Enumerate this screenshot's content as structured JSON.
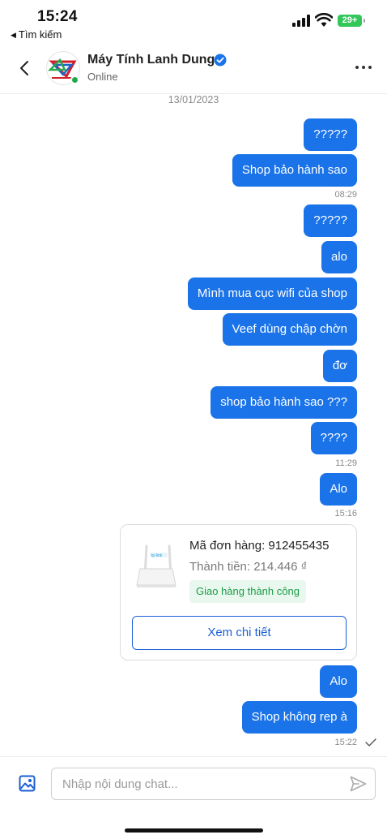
{
  "status_bar": {
    "time": "15:24",
    "back_label": "Tìm kiếm",
    "battery": "29+"
  },
  "header": {
    "shop_name": "Máy Tính Lanh Dung",
    "status": "Online"
  },
  "chat": {
    "date": "13/01/2023",
    "messages": [
      {
        "text": "?????"
      },
      {
        "text": "Shop bảo hành sao"
      },
      {
        "text": "?????"
      },
      {
        "text": "alo"
      },
      {
        "text": "Mình mua cục wifi của shop"
      },
      {
        "text": "Veef dùng chập chờn"
      },
      {
        "text": "đơ"
      },
      {
        "text": "shop bảo hành sao ???"
      },
      {
        "text": "????"
      },
      {
        "text": "Alo"
      },
      {
        "text": "Alo"
      },
      {
        "text": "Shop không rep à"
      }
    ],
    "timestamps": [
      "08:29",
      "11:29",
      "15:16",
      "15:22"
    ],
    "order": {
      "order_id": "Mã đơn hàng: 912455435",
      "total": "Thành tiền: 214.446 ₫",
      "status": "Giao hàng thành công",
      "detail_button": "Xem chi tiết",
      "status_color": "#1d9b47"
    }
  },
  "input": {
    "placeholder": "Nhập nội dung chat...",
    "value": ""
  },
  "colors": {
    "accent": "#1a73e8",
    "online": "#1faa4a",
    "battery": "#31c75b"
  },
  "icons": [
    "back-chevron-icon",
    "verified-badge-icon",
    "more-dots-icon",
    "image-icon",
    "send-icon",
    "seen-check-icon",
    "signal-icon",
    "wifi-icon",
    "battery-icon"
  ]
}
